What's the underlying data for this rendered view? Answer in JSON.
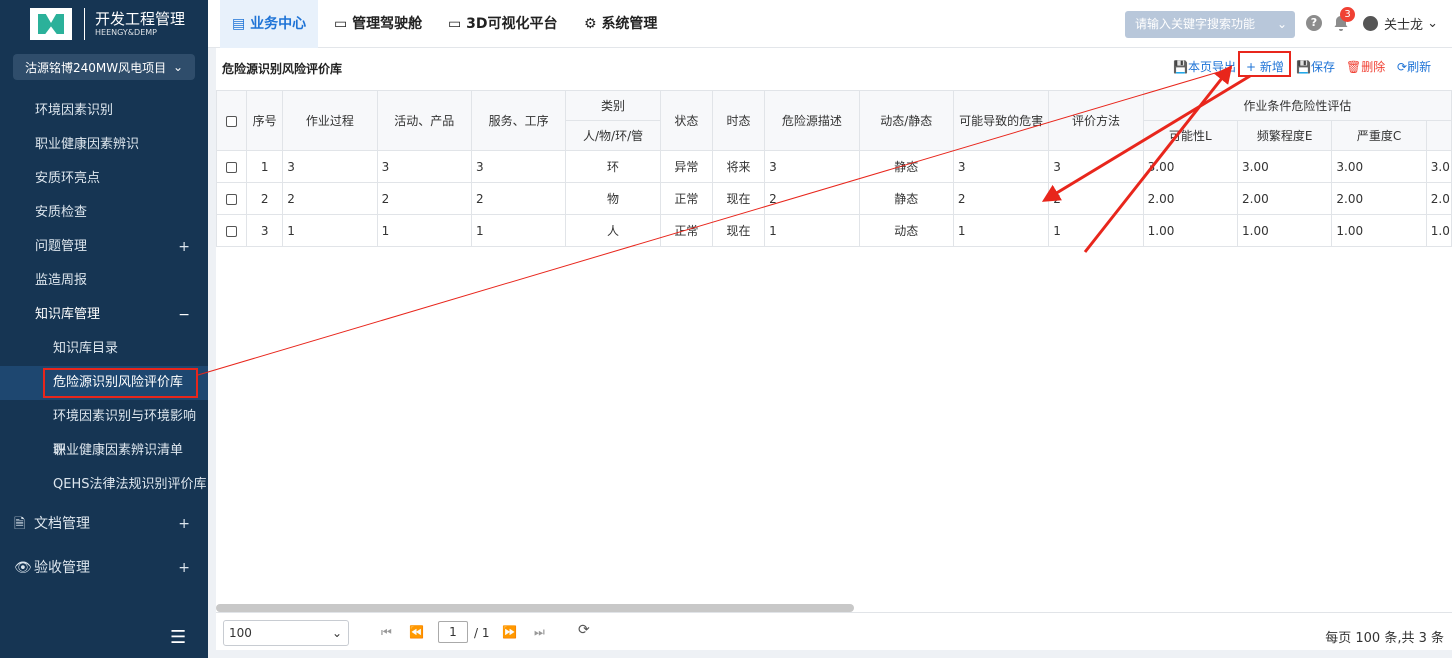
{
  "app": {
    "title": "开发工程管理",
    "subtitle": "HEENGY&DEMP"
  },
  "project": {
    "name": "沽源铭博240MW风电项目"
  },
  "sidebar": {
    "items": [
      {
        "label": "环境因素识别"
      },
      {
        "label": "职业健康因素辨识"
      },
      {
        "label": "安质环亮点"
      },
      {
        "label": "安质检查"
      },
      {
        "label": "问题管理",
        "toggle": "+"
      },
      {
        "label": "监造周报"
      },
      {
        "label": "知识库管理",
        "toggle": "−"
      },
      {
        "label": "知识库目录"
      },
      {
        "label": "危险源识别风险评价库"
      },
      {
        "label": "环境因素识别与环境影响评"
      },
      {
        "label": "职业健康因素辨识清单"
      },
      {
        "label": "QEHS法律法规识别评价库"
      }
    ],
    "groups": [
      {
        "label": "文档管理",
        "toggle": "+"
      },
      {
        "label": "验收管理",
        "toggle": "+"
      }
    ]
  },
  "topnav": {
    "tabs": [
      {
        "label": "业务中心"
      },
      {
        "label": "管理驾驶舱"
      },
      {
        "label": "3D可视化平台"
      },
      {
        "label": "系统管理"
      }
    ],
    "search_placeholder": "请输入关键字搜索功能",
    "notifications": "3",
    "user": "关士龙"
  },
  "panel": {
    "title": "危险源识别风险评价库",
    "toolbar": {
      "export": "本页导出",
      "add": "新增",
      "save": "保存",
      "delete": "删除",
      "refresh": "刷新"
    }
  },
  "table": {
    "headers": {
      "seq": "序号",
      "process": "作业过程",
      "activity": "活动、产品",
      "service": "服务、工序",
      "category": "类别",
      "category_sub": "人/物/环/管",
      "state": "状态",
      "tense": "时态",
      "hazard_desc": "危险源描述",
      "dynamic": "动态/静态",
      "harm": "可能导致的危害",
      "eval_method": "评价方法",
      "risk_group": "作业条件危险性评估",
      "L": "可能性L",
      "E": "频繁程度E",
      "C": "严重度C"
    },
    "rows": [
      {
        "seq": "1",
        "process": "3",
        "activity": "3",
        "service": "3",
        "category": "环",
        "state": "异常",
        "tense": "将来",
        "desc": "3",
        "dyn": "静态",
        "harm": "3",
        "method": "3",
        "L": "3.00",
        "E": "3.00",
        "C": "3.00",
        "D": "3.0"
      },
      {
        "seq": "2",
        "process": "2",
        "activity": "2",
        "service": "2",
        "category": "物",
        "state": "正常",
        "tense": "现在",
        "desc": "2",
        "dyn": "静态",
        "harm": "2",
        "method": "2",
        "L": "2.00",
        "E": "2.00",
        "C": "2.00",
        "D": "2.0"
      },
      {
        "seq": "3",
        "process": "1",
        "activity": "1",
        "service": "1",
        "category": "人",
        "state": "正常",
        "tense": "现在",
        "desc": "1",
        "dyn": "动态",
        "harm": "1",
        "method": "1",
        "L": "1.00",
        "E": "1.00",
        "C": "1.00",
        "D": "1.0"
      }
    ]
  },
  "pager": {
    "page_size": "100",
    "page": "1",
    "total_pages": "/ 1",
    "info": "每页 100 条,共 3 条"
  },
  "colors": {
    "sidebar": "#163553",
    "accent": "#1e73d6",
    "annotation": "#e8261c"
  }
}
